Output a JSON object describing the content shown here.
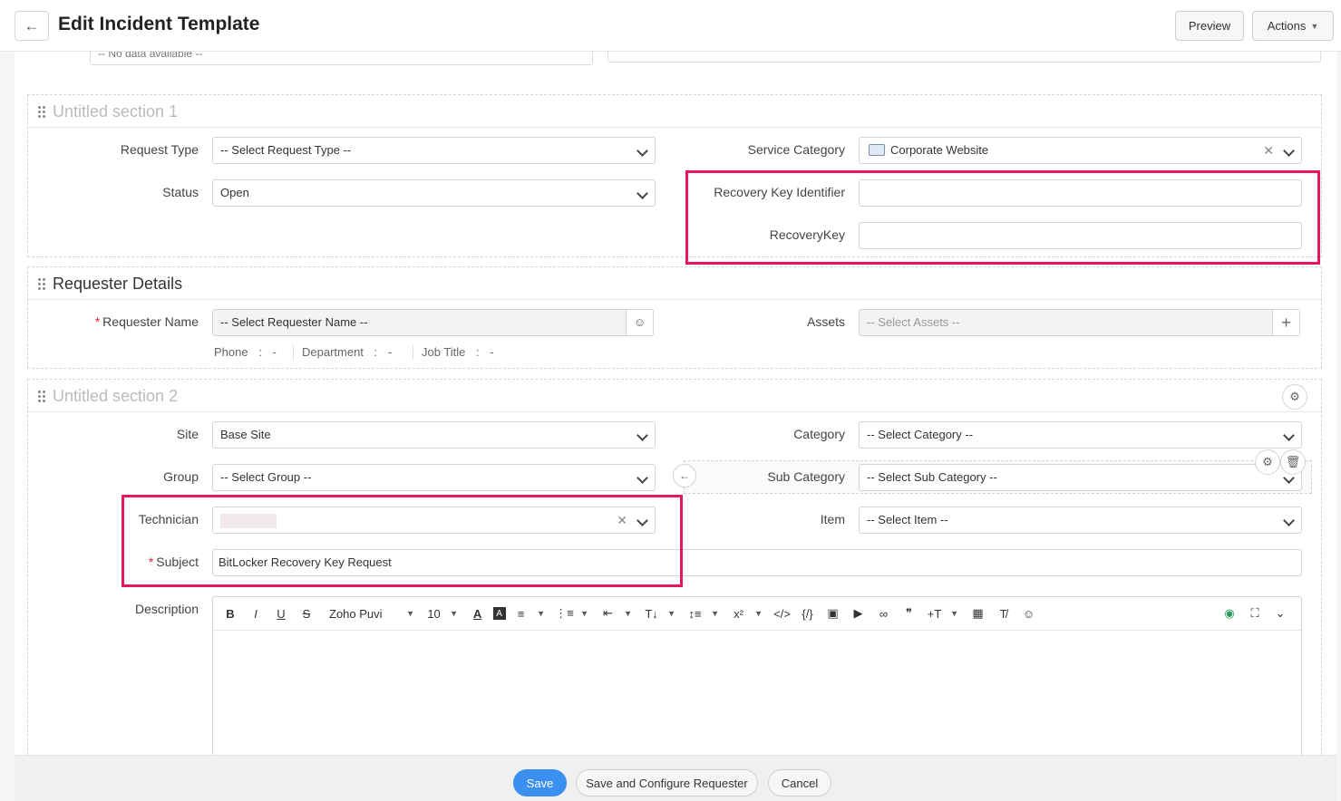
{
  "header": {
    "title": "Edit Incident Template",
    "preview_label": "Preview",
    "actions_label": "Actions"
  },
  "top_remnant": {
    "no_data_text": "-- No data available --"
  },
  "section1": {
    "title": "Untitled section 1",
    "request_type": {
      "label": "Request Type",
      "value": "-- Select Request Type --"
    },
    "status": {
      "label": "Status",
      "value": "Open"
    },
    "service_category": {
      "label": "Service Category",
      "value": "Corporate Website"
    },
    "recovery_key_identifier": {
      "label": "Recovery Key Identifier",
      "value": ""
    },
    "recovery_key": {
      "label": "RecoveryKey",
      "value": ""
    }
  },
  "requester": {
    "title": "Requester Details",
    "name": {
      "label": "Requester Name",
      "value": "-- Select Requester Name --"
    },
    "assets": {
      "label": "Assets",
      "value": "-- Select Assets --"
    },
    "phone_label": "Phone",
    "phone_value": "-",
    "department_label": "Department",
    "department_value": "-",
    "job_title_label": "Job Title",
    "job_title_value": "-",
    "separator": ":",
    "required_mark": "*"
  },
  "section2": {
    "title": "Untitled section 2",
    "site": {
      "label": "Site",
      "value": "Base Site"
    },
    "group": {
      "label": "Group",
      "value": "-- Select Group --"
    },
    "technician": {
      "label": "Technician",
      "value": ""
    },
    "subject": {
      "label": "Subject",
      "value": "BitLocker Recovery Key Request"
    },
    "category": {
      "label": "Category",
      "value": "-- Select Category --"
    },
    "sub_category": {
      "label": "Sub Category",
      "value": "-- Select Sub Category --"
    },
    "item": {
      "label": "Item",
      "value": "-- Select Item --"
    },
    "description": {
      "label": "Description"
    }
  },
  "editor": {
    "font_name": "Zoho Puvi",
    "font_size": "10"
  },
  "footer": {
    "save_label": "Save",
    "save_config_label": "Save and Configure Requester",
    "cancel_label": "Cancel"
  },
  "colors": {
    "highlight": "#e8175d",
    "primary": "#3b8ff0",
    "required": "#e0262b"
  }
}
